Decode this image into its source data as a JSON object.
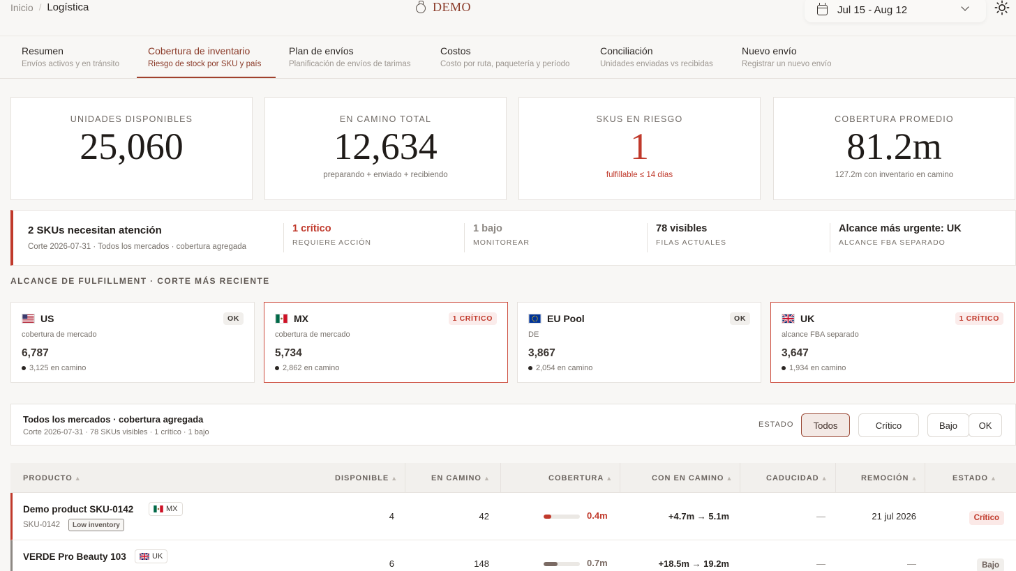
{
  "breadcrumb": {
    "home": "Inicio",
    "separator": "/",
    "current": "Logística"
  },
  "brand": {
    "name": "DEMO",
    "icon": "bell-jar-icon"
  },
  "date_range": {
    "label": "Jul 15 - Aug 12",
    "icon": "calendar-icon"
  },
  "theme_toggle": {
    "icon": "sun-icon"
  },
  "tabs": [
    {
      "title": "Resumen",
      "subtitle": "Envíos activos y en tránsito"
    },
    {
      "title": "Cobertura de inventario",
      "subtitle": "Riesgo de stock por SKU y país",
      "active": true
    },
    {
      "title": "Plan de envíos",
      "subtitle": "Planificación de envíos de tarimas"
    },
    {
      "title": "Costos",
      "subtitle": "Costo por ruta, paquetería y período"
    },
    {
      "title": "Conciliación",
      "subtitle": "Unidades enviadas vs recibidas"
    },
    {
      "title": "Nuevo envío",
      "subtitle": "Registrar un nuevo envío"
    }
  ],
  "kpis": [
    {
      "label": "UNIDADES DISPONIBLES",
      "value": "25,060",
      "sub": ""
    },
    {
      "label": "EN CAMINO TOTAL",
      "value": "12,634",
      "sub": "preparando + enviado + recibiendo"
    },
    {
      "label": "SKUS EN RIESGO",
      "value": "1",
      "sub": "fulfillable ≤ 14 días"
    },
    {
      "label": "COBERTURA PROMEDIO",
      "value": "81.2m",
      "sub": "127.2m con inventario en camino"
    }
  ],
  "banner": {
    "title": "2 SKUs necesitan atención",
    "subtitle": "Corte 2026-07-31 · Todos los mercados · cobertura agregada",
    "stats": [
      {
        "value": "1 crítico",
        "label": "REQUIERE ACCIÓN"
      },
      {
        "value": "1 bajo",
        "label": "MONITOREAR"
      },
      {
        "value": "78 visibles",
        "label": "FILAS ACTUALES"
      },
      {
        "value": "Alcance más urgente: UK",
        "label": "ALCANCE FBA SEPARADO"
      }
    ]
  },
  "fulfillment_section": {
    "heading": "ALCANCE DE FULFILLMENT · CORTE MÁS RECIENTE"
  },
  "markets": [
    {
      "name": "US",
      "flag": "us-flag-icon",
      "badge": "OK",
      "desc": "cobertura de mercado",
      "units": "6,787",
      "transit": "3,125 en camino"
    },
    {
      "name": "MX",
      "flag": "mx-flag-icon",
      "badge": "1 CRÍTICO",
      "desc": "cobertura de mercado",
      "units": "5,734",
      "transit": "2,862 en camino"
    },
    {
      "name": "EU Pool",
      "flag": "eu-flag-icon",
      "badge": "OK",
      "desc": "DE",
      "units": "3,867",
      "transit": "2,054 en camino"
    },
    {
      "name": "UK",
      "flag": "uk-flag-icon",
      "badge": "1 CRÍTICO",
      "desc": "alcance FBA separado",
      "units": "3,647",
      "transit": "1,934 en camino"
    }
  ],
  "filter": {
    "title": "Todos los mercados · cobertura agregada",
    "subtitle": "Corte 2026-07-31 · 78 SKUs visibles · 1 crítico · 1 bajo",
    "estado_label": "ESTADO",
    "options": [
      "Todos",
      "Crítico",
      "Bajo",
      "OK"
    ],
    "selected": "Todos"
  },
  "table": {
    "sort_glyph": "▲",
    "columns": [
      "PRODUCTO",
      "DISPONIBLE",
      "EN CAMINO",
      "COBERTURA",
      "CON EN CAMINO",
      "CADUCIDAD",
      "REMOCIÓN",
      "ESTADO"
    ],
    "rows": [
      {
        "name": "Demo product SKU-0142",
        "market": "MX",
        "sku": "SKU-0142",
        "tag": "Low inventory",
        "disponible": "4",
        "en_camino": "42",
        "coverage_pct": 0.22,
        "cobertura": "0.4m",
        "con_en_camino": "+4.7m → 5.1m",
        "caducidad": "—",
        "remocion": "21 jul 2026",
        "estado": "Crítico",
        "color": "#c0392b"
      },
      {
        "name": "VERDE Pro Beauty 103",
        "market": "UK",
        "sku": "",
        "tag": "",
        "disponible": "6",
        "en_camino": "148",
        "coverage_pct": 0.38,
        "cobertura": "0.7m",
        "con_en_camino": "+18.5m → 19.2m",
        "caducidad": "—",
        "remocion": "—",
        "estado": "Bajo",
        "color": "#7a6a63"
      }
    ]
  }
}
